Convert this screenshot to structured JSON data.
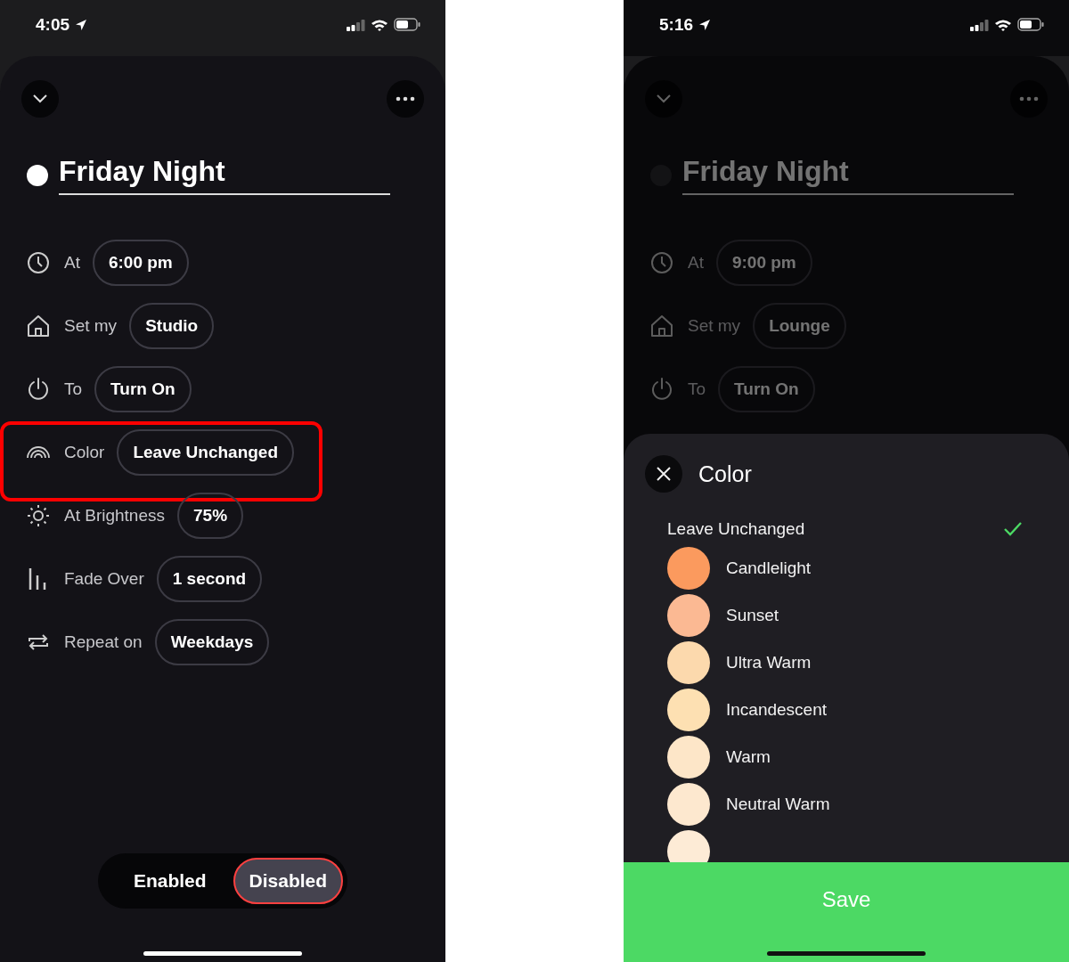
{
  "screens": [
    {
      "dimmed": false,
      "status_bar": {
        "time": "4:05"
      },
      "schedule": {
        "light_on": true,
        "name": "Friday Night",
        "rows": [
          {
            "kind": "clock",
            "label": "At",
            "value": "6:00 pm",
            "highlighted": false
          },
          {
            "kind": "home",
            "label": "Set my",
            "value": "Studio",
            "highlighted": false
          },
          {
            "kind": "power",
            "label": "To",
            "value": "Turn On",
            "highlighted": false
          },
          {
            "kind": "rainbow",
            "label": "Color",
            "value": "Leave Unchanged",
            "highlighted": true
          },
          {
            "kind": "sun",
            "label": "At Brightness",
            "value": "75%",
            "highlighted": false
          },
          {
            "kind": "bars",
            "label": "Fade Over",
            "value": "1 second",
            "highlighted": false
          },
          {
            "kind": "repeat",
            "label": "Repeat on",
            "value": "Weekdays",
            "highlighted": false
          }
        ]
      },
      "toggle": [
        {
          "label": "Enabled",
          "selected": false
        },
        {
          "label": "Disabled",
          "selected": true
        }
      ]
    },
    {
      "dimmed": true,
      "status_bar": {
        "time": "5:16"
      },
      "schedule": {
        "light_on": false,
        "name": "Friday Night",
        "rows": [
          {
            "kind": "clock",
            "label": "At",
            "value": "9:00 pm",
            "highlighted": false
          },
          {
            "kind": "home",
            "label": "Set my",
            "value": "Lounge",
            "highlighted": false
          },
          {
            "kind": "power",
            "label": "To",
            "value": "Turn On",
            "highlighted": false
          }
        ]
      },
      "color_sheet": {
        "title": "Color",
        "options": [
          {
            "label": "Leave Unchanged",
            "selected": true
          },
          {
            "label": "Candlelight",
            "color": "#fb9a5e",
            "selected": false
          },
          {
            "label": "Sunset",
            "color": "#fbb993",
            "selected": false
          },
          {
            "label": "Ultra Warm",
            "color": "#fcd9ad",
            "selected": false
          },
          {
            "label": "Incandescent",
            "color": "#fde0b2",
            "selected": false
          },
          {
            "label": "Warm",
            "color": "#fde6c8",
            "selected": false
          },
          {
            "label": "Neutral Warm",
            "color": "#fde8cf",
            "selected": false
          },
          {
            "color": "#fdebd6",
            "selected": false
          }
        ],
        "save_button": "Save"
      }
    }
  ]
}
